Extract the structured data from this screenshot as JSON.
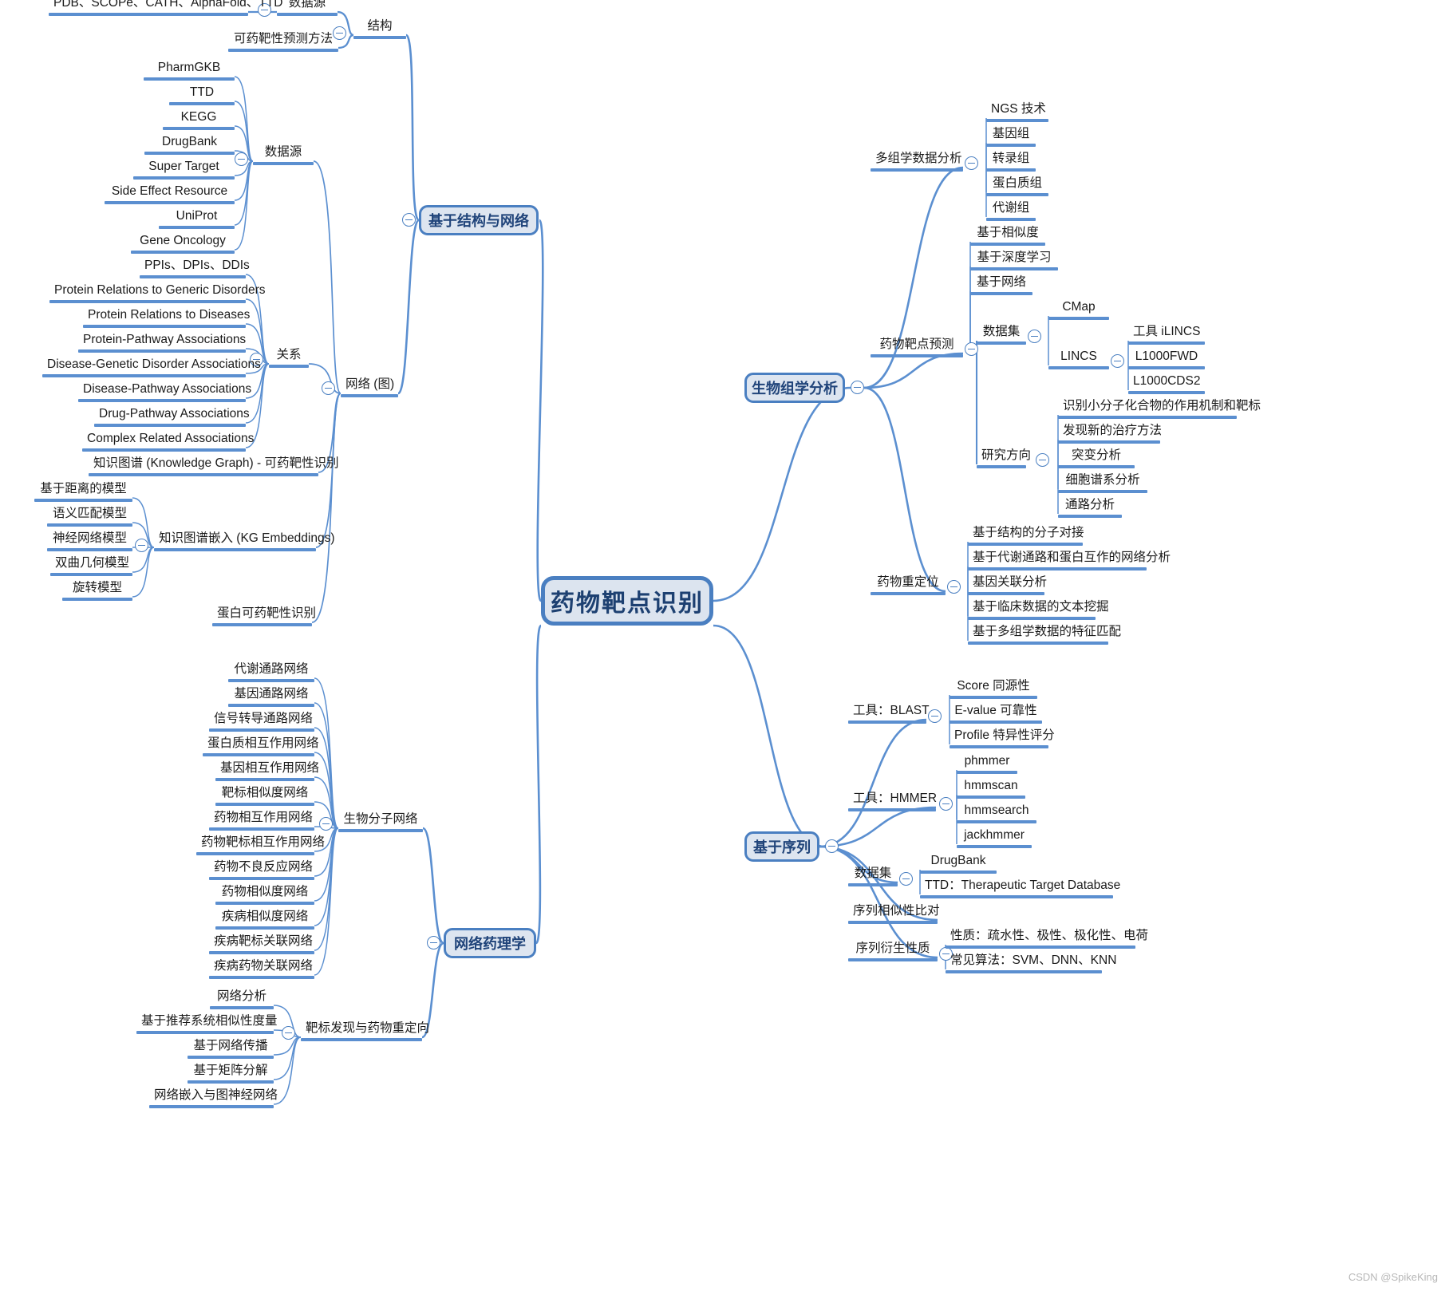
{
  "root": {
    "label": "药物靶点识别"
  },
  "colors": {
    "line": "#5b8fd0",
    "box_fill": "#dde5f0",
    "box_border": "#4a7fc1",
    "text": "#1a1a1a",
    "box_text": "#20447a"
  },
  "watermark": "CSDN @SpikeKing",
  "branches": {
    "structure_network": {
      "label": "基于结构与网络",
      "children": {
        "structure": {
          "label": "结构",
          "children": {
            "datasource": {
              "label": "数据源",
              "children": [
                "PDB、SCOPe、CATH、AlphaFold、TTD"
              ]
            },
            "druggability": {
              "label": "可药靶性预测方法"
            }
          }
        },
        "network_graph": {
          "label": "网络 (图)",
          "children": {
            "datasource": {
              "label": "数据源",
              "children": [
                "PharmGKB",
                "TTD",
                "KEGG",
                "DrugBank",
                "Super Target",
                "Side Effect Resource",
                "UniProt",
                "Gene Oncology"
              ]
            },
            "relations": {
              "label": "关系",
              "children": [
                "PPIs、DPIs、DDIs",
                "Protein Relations to Generic Disorders",
                "Protein Relations to Diseases",
                "Protein-Pathway Associations",
                "Disease-Genetic Disorder Associations",
                "Disease-Pathway Associations",
                "Drug-Pathway Associations",
                "Complex Related Associations"
              ]
            },
            "kg": {
              "label": "知识图谱 (Knowledge Graph) - 可药靶性识别"
            },
            "kg_embeddings": {
              "label": "知识图谱嵌入 (KG Embeddings)",
              "children": [
                "基于距离的模型",
                "语义匹配模型",
                "神经网络模型",
                "双曲几何模型",
                "旋转模型"
              ]
            },
            "protein_drug": {
              "label": "蛋白可药靶性识别"
            }
          }
        }
      }
    },
    "bio_omics": {
      "label": "生物组学分析",
      "children": {
        "multiomics": {
          "label": "多组学数据分析",
          "children": [
            "NGS 技术",
            "基因组",
            "转录组",
            "蛋白质组",
            "代谢组"
          ]
        },
        "target_pred": {
          "label": "药物靶点预测",
          "children": [
            "基于相似度",
            "基于深度学习",
            "基于网络"
          ],
          "dataset": {
            "label": "数据集",
            "children": {
              "cmap": {
                "label": "CMap"
              },
              "lincs": {
                "label": "LINCS",
                "children": [
                  "工具 iLINCS",
                  "L1000FWD",
                  "L1000CDS2"
                ]
              }
            }
          },
          "research": {
            "label": "研究方向",
            "children": [
              "识别小分子化合物的作用机制和靶标",
              "发现新的治疗方法",
              "突变分析",
              "细胞谱系分析",
              "通路分析"
            ]
          }
        },
        "repurposing": {
          "label": "药物重定位",
          "children": [
            "基于结构的分子对接",
            "基于代谢通路和蛋白互作的网络分析",
            "基因关联分析",
            "基于临床数据的文本挖掘",
            "基于多组学数据的特征匹配"
          ]
        }
      }
    },
    "sequence": {
      "label": "基于序列",
      "children": {
        "blast": {
          "label": "工具：BLAST",
          "children": [
            "Score 同源性",
            "E-value 可靠性",
            "Profile 特异性评分"
          ]
        },
        "hmmer": {
          "label": "工具：HMMER",
          "children": [
            "phmmer",
            "hmmscan",
            "hmmsearch",
            "jackhmmer"
          ]
        },
        "dataset": {
          "label": "数据集",
          "children": [
            "DrugBank",
            "TTD：Therapeutic Target Database"
          ]
        },
        "alignment": {
          "label": "序列相似性比对"
        },
        "derived": {
          "label": "序列衍生性质",
          "children": [
            "性质：疏水性、极性、极化性、电荷",
            "常见算法：SVM、DNN、KNN"
          ]
        }
      }
    },
    "network_pharmacology": {
      "label": "网络药理学",
      "children": {
        "biomolecular": {
          "label": "生物分子网络",
          "children": [
            "代谢通路网络",
            "基因通路网络",
            "信号转导通路网络",
            "蛋白质相互作用网络",
            "基因相互作用网络",
            "靶标相似度网络",
            "药物相互作用网络",
            "药物靶标相互作用网络",
            "药物不良反应网络",
            "药物相似度网络",
            "疾病相似度网络",
            "疾病靶标关联网络",
            "疾病药物关联网络"
          ]
        },
        "discovery": {
          "label": "靶标发现与药物重定向",
          "children": [
            "网络分析",
            "基于推荐系统相似性度量",
            "基于网络传播",
            "基于矩阵分解",
            "网络嵌入与图神经网络"
          ]
        }
      }
    }
  }
}
